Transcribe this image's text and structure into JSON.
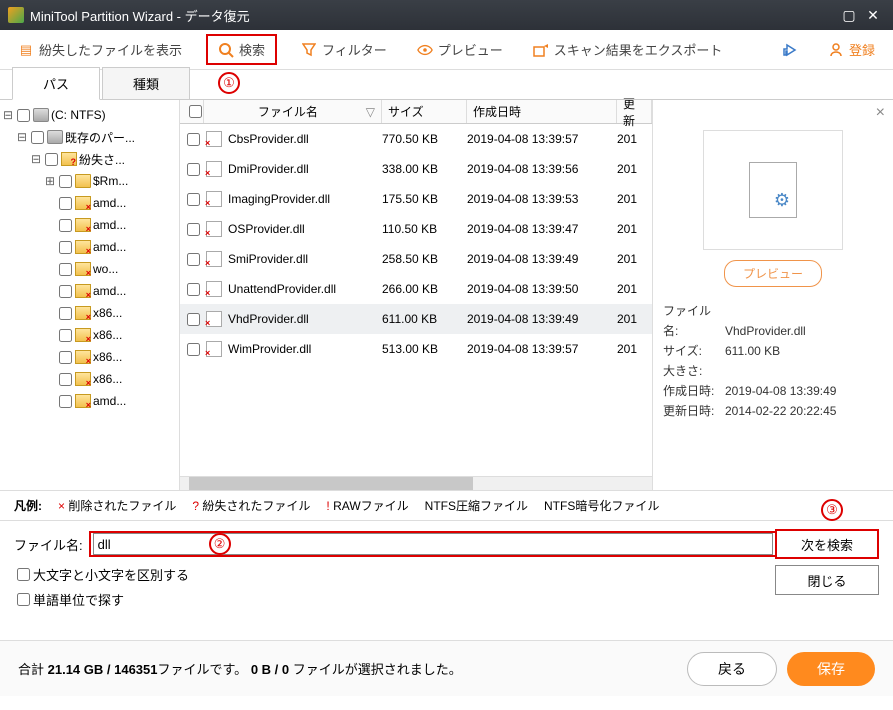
{
  "window": {
    "title": "MiniTool Partition Wizard - データ復元"
  },
  "toolbar": {
    "showLost": "紛失したファイルを表示",
    "search": "検索",
    "filter": "フィルター",
    "preview": "プレビュー",
    "export": "スキャン結果をエクスポート",
    "register": "登録"
  },
  "tabs": {
    "path": "パス",
    "type": "種類"
  },
  "annotations": {
    "a1": "①",
    "a2": "②",
    "a3": "③"
  },
  "tree": {
    "root": "(C: NTFS)",
    "existing": "既存のパー...",
    "lost": "紛失さ...",
    "items": [
      "$Rm...",
      "amd...",
      "amd...",
      "amd...",
      "wo...",
      "amd...",
      "x86...",
      "x86...",
      "x86...",
      "x86...",
      "amd..."
    ]
  },
  "columns": {
    "name": "ファイル名",
    "size": "サイズ",
    "created": "作成日時",
    "updated": "更新"
  },
  "files": [
    {
      "name": "CbsProvider.dll",
      "size": "770.50 KB",
      "created": "2019-04-08 13:39:57",
      "upd": "201"
    },
    {
      "name": "DmiProvider.dll",
      "size": "338.00 KB",
      "created": "2019-04-08 13:39:56",
      "upd": "201"
    },
    {
      "name": "ImagingProvider.dll",
      "size": "175.50 KB",
      "created": "2019-04-08 13:39:53",
      "upd": "201"
    },
    {
      "name": "OSProvider.dll",
      "size": "110.50 KB",
      "created": "2019-04-08 13:39:47",
      "upd": "201"
    },
    {
      "name": "SmiProvider.dll",
      "size": "258.50 KB",
      "created": "2019-04-08 13:39:49",
      "upd": "201"
    },
    {
      "name": "UnattendProvider.dll",
      "size": "266.00 KB",
      "created": "2019-04-08 13:39:50",
      "upd": "201"
    },
    {
      "name": "VhdProvider.dll",
      "size": "611.00 KB",
      "created": "2019-04-08 13:39:49",
      "upd": "201"
    },
    {
      "name": "WimProvider.dll",
      "size": "513.00 KB",
      "created": "2019-04-08 13:39:57",
      "upd": "201"
    }
  ],
  "previewPane": {
    "button": "プレビュー",
    "labels": {
      "filename": "ファイル名:",
      "size": "サイズ:",
      "dim": "大きさ:",
      "created": "作成日時:",
      "updated": "更新日時:"
    },
    "values": {
      "filename": "VhdProvider.dll",
      "size": "611.00 KB",
      "dim": "",
      "created": "2019-04-08 13:39:49",
      "updated": "2014-02-22 20:22:45"
    }
  },
  "legend": {
    "title": "凡例:",
    "deleted": "削除されたファイル",
    "lost": "紛失されたファイル",
    "raw": "RAWファイル",
    "ntfsComp": "NTFS圧縮ファイル",
    "ntfsEnc": "NTFS暗号化ファイル"
  },
  "searchPane": {
    "label": "ファイル名:",
    "value": "dll",
    "matchCase": "大文字と小文字を区別する",
    "wholeWord": "単語単位で探す",
    "findNext": "次を検索",
    "close": "閉じる"
  },
  "footer": {
    "text_a": "合計 ",
    "text_b": "21.14 GB / 146351",
    "text_c": "ファイルです。",
    "text_d": "0 B / 0 ",
    "text_e": "ファイルが選択されました。",
    "back": "戻る",
    "save": "保存"
  }
}
